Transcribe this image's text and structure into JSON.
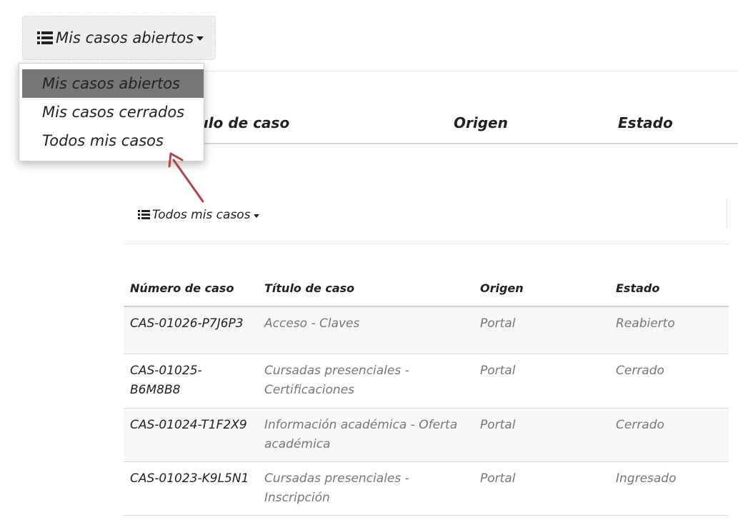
{
  "top_menu": {
    "button_label": "Mis casos abiertos",
    "items": [
      {
        "label": "Mis casos abiertos",
        "active": true
      },
      {
        "label": "Mis casos cerrados",
        "active": false
      },
      {
        "label": "Todos mis casos",
        "active": false
      }
    ],
    "headers": [
      "tulo de caso",
      "Origen",
      "Estado"
    ]
  },
  "colors": {
    "active_item": "#777777",
    "arrow": "#b14444"
  },
  "icons": {
    "list": "list-icon",
    "caret": "caret-down-icon"
  },
  "bottom_menu": {
    "button_label": "Todos mis casos"
  },
  "table": {
    "headers": [
      "Número de caso",
      "Título de caso",
      "Origen",
      "Estado"
    ],
    "rows": [
      {
        "number": "CAS-01026-P7J6P3",
        "title": "Acceso - Claves",
        "origin": "Portal",
        "status": "Reabierto"
      },
      {
        "number": "CAS-01025-B6M8B8",
        "title": "Cursadas presenciales - Certificaciones",
        "origin": "Portal",
        "status": "Cerrado"
      },
      {
        "number": "CAS-01024-T1F2X9",
        "title": "Información académica - Oferta académica",
        "origin": "Portal",
        "status": "Cerrado"
      },
      {
        "number": "CAS-01023-K9L5N1",
        "title": "Cursadas presenciales - Inscripción",
        "origin": "Portal",
        "status": "Ingresado"
      }
    ]
  }
}
